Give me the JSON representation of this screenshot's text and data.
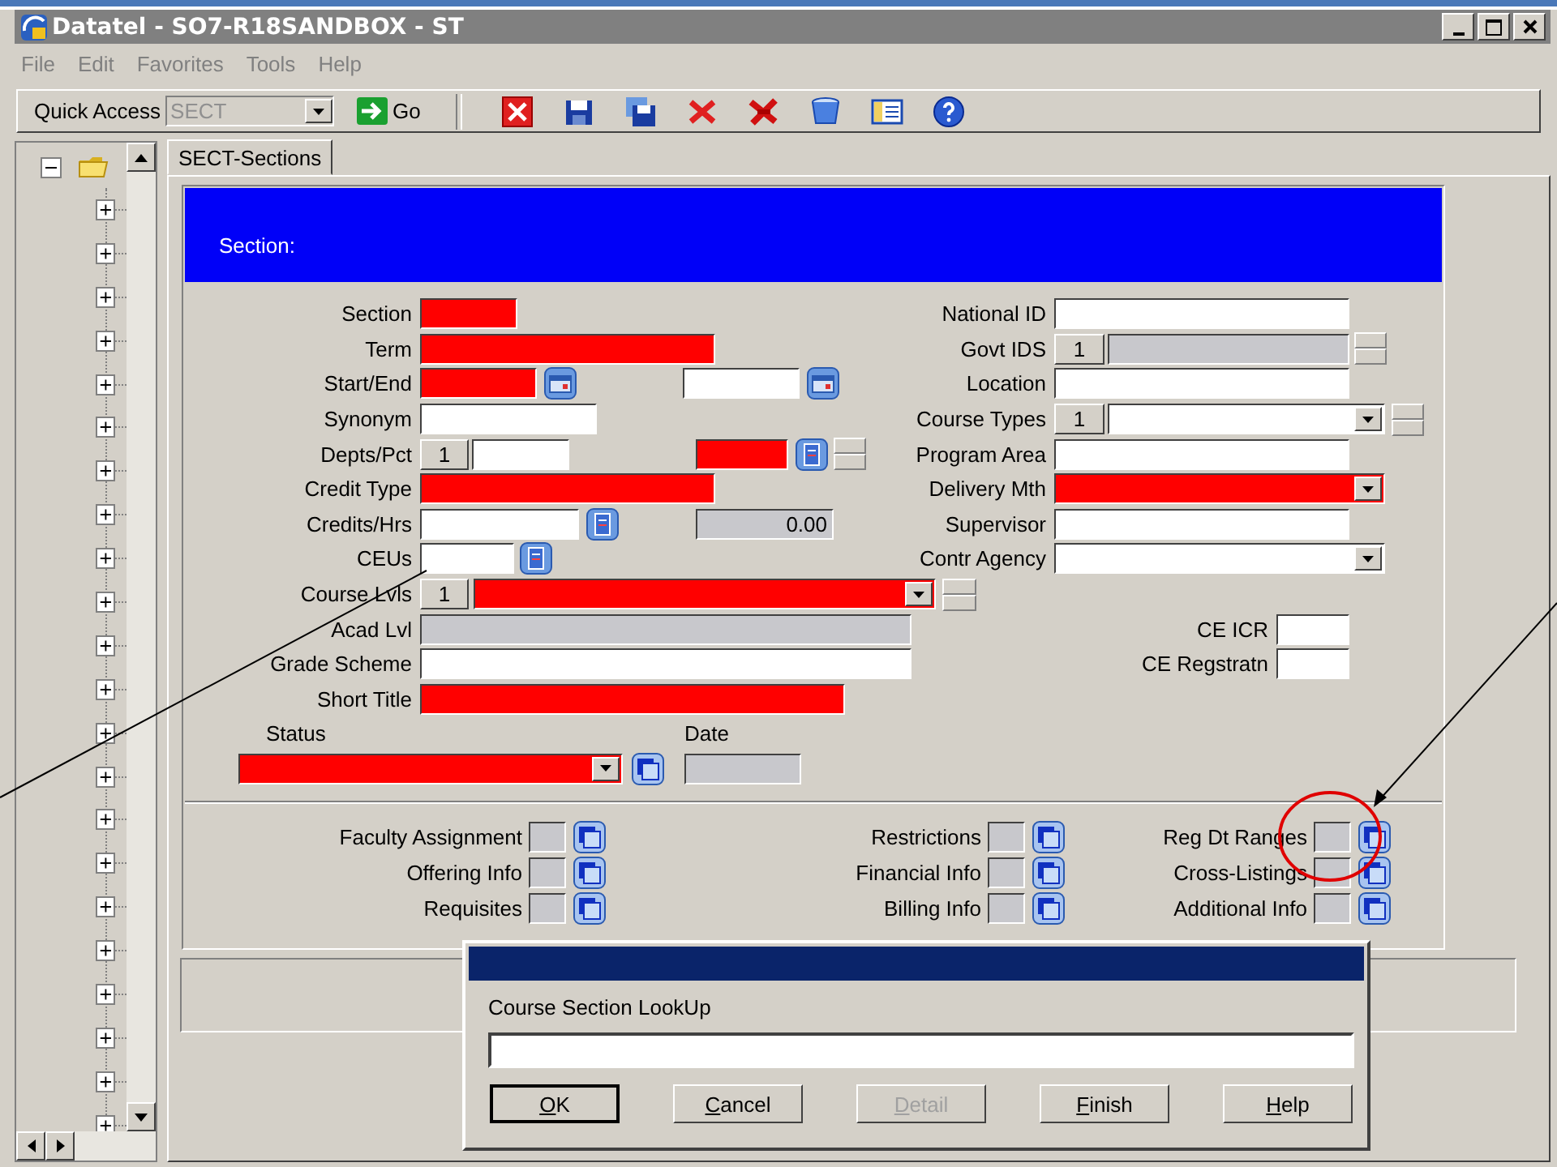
{
  "window": {
    "title": "Datatel - SO7-R18SANDBOX - ST"
  },
  "menu": [
    "File",
    "Edit",
    "Favorites",
    "Tools",
    "Help"
  ],
  "toolbar": {
    "quick_access_label": "Quick Access",
    "quick_access_value": "SECT",
    "quick_access_disabled": true,
    "go_label": "Go"
  },
  "tree": {
    "expanded": true,
    "children": [
      {
        "expanded": false
      },
      {
        "expanded": false
      },
      {
        "expanded": false
      },
      {
        "expanded": false
      },
      {
        "expanded": false
      },
      {
        "expanded": false
      },
      {
        "expanded": false
      },
      {
        "expanded": false
      },
      {
        "expanded": false
      },
      {
        "expanded": false
      },
      {
        "expanded": false
      },
      {
        "expanded": false
      },
      {
        "expanded": false
      },
      {
        "expanded": false
      },
      {
        "expanded": false
      },
      {
        "expanded": false
      },
      {
        "expanded": false
      },
      {
        "expanded": false
      },
      {
        "expanded": false
      },
      {
        "expanded": false
      },
      {
        "expanded": false
      },
      {
        "expanded": false
      }
    ]
  },
  "tabs": [
    {
      "label": "SECT-Sections",
      "selected": true
    }
  ],
  "form": {
    "header": "Section:",
    "left_rows": [
      {
        "label": "Section",
        "controls": [
          {
            "kind": "field",
            "required": true
          }
        ]
      },
      {
        "label": "Term",
        "controls": [
          {
            "kind": "field",
            "required": true
          }
        ]
      },
      {
        "label": "Start/End",
        "controls": [
          {
            "kind": "field",
            "required": true
          },
          {
            "kind": "calendar"
          },
          {
            "kind": "field",
            "required": false
          },
          {
            "kind": "calendar"
          }
        ]
      },
      {
        "label": "Synonym",
        "controls": [
          {
            "kind": "field",
            "required": false
          }
        ]
      },
      {
        "label": "Depts/Pct",
        "controls": [
          {
            "kind": "counter",
            "value": "1"
          },
          {
            "kind": "field",
            "required": false
          },
          {
            "kind": "field",
            "required": true
          },
          {
            "kind": "detail"
          },
          {
            "kind": "spinner"
          }
        ]
      },
      {
        "label": "Credit Type",
        "controls": [
          {
            "kind": "field",
            "required": true
          }
        ]
      },
      {
        "label": "Credits/Hrs",
        "controls": [
          {
            "kind": "field",
            "required": false
          },
          {
            "kind": "detail"
          },
          {
            "kind": "display",
            "value": "0.00"
          }
        ]
      },
      {
        "label": "CEUs",
        "controls": [
          {
            "kind": "field",
            "required": false
          },
          {
            "kind": "detail"
          }
        ]
      },
      {
        "label": "Course Lvls",
        "controls": [
          {
            "kind": "counter",
            "value": "1"
          },
          {
            "kind": "dropdown",
            "required": true
          },
          {
            "kind": "spinner"
          }
        ]
      },
      {
        "label": "Acad Lvl",
        "controls": [
          {
            "kind": "display"
          }
        ]
      },
      {
        "label": "Grade Scheme",
        "controls": [
          {
            "kind": "field",
            "required": false
          }
        ]
      },
      {
        "label": "Short Title",
        "controls": [
          {
            "kind": "field",
            "required": true
          }
        ]
      }
    ],
    "right_rows": [
      {
        "label": "National ID",
        "controls": [
          {
            "kind": "field",
            "required": false
          }
        ]
      },
      {
        "label": "Govt IDS",
        "controls": [
          {
            "kind": "counter",
            "value": "1"
          },
          {
            "kind": "display"
          },
          {
            "kind": "spinner"
          }
        ]
      },
      {
        "label": "Location",
        "controls": [
          {
            "kind": "field",
            "required": false
          }
        ]
      },
      {
        "label": "Course Types",
        "controls": [
          {
            "kind": "counter",
            "value": "1"
          },
          {
            "kind": "dropdown",
            "required": false
          },
          {
            "kind": "spinner"
          }
        ]
      },
      {
        "label": "Program Area",
        "controls": [
          {
            "kind": "field",
            "required": false
          }
        ]
      },
      {
        "label": "Delivery Mth",
        "controls": [
          {
            "kind": "dropdown",
            "required": true
          }
        ]
      },
      {
        "label": "Supervisor",
        "controls": [
          {
            "kind": "field",
            "required": false
          }
        ]
      },
      {
        "label": "Contr Agency",
        "controls": [
          {
            "kind": "dropdown",
            "required": false
          }
        ]
      },
      {
        "label": "CE ICR",
        "controls": [
          {
            "kind": "field",
            "required": false
          }
        ]
      },
      {
        "label": "CE Regstratn",
        "controls": [
          {
            "kind": "field",
            "required": false
          }
        ]
      }
    ],
    "status_label": "Status",
    "date_label": "Date",
    "status_controls": [
      {
        "kind": "dropdown",
        "required": true
      },
      {
        "kind": "lookup"
      },
      {
        "kind": "display"
      }
    ],
    "links": [
      [
        {
          "label": "Faculty Assignment"
        },
        {
          "label": "Offering Info"
        },
        {
          "label": "Requisites"
        }
      ],
      [
        {
          "label": "Restrictions"
        },
        {
          "label": "Financial Info"
        },
        {
          "label": "Billing Info"
        }
      ],
      [
        {
          "label": "Reg Dt Ranges"
        },
        {
          "label": "Cross-Listings"
        },
        {
          "label": "Additional Info"
        }
      ]
    ]
  },
  "dialog": {
    "prompt": "Course Section LookUp",
    "buttons": [
      {
        "label": "OK",
        "default": true,
        "disabled": false
      },
      {
        "label": "Cancel",
        "default": false,
        "disabled": false
      },
      {
        "label": "Detail",
        "default": false,
        "disabled": true
      },
      {
        "label": "Finish",
        "default": false,
        "disabled": false
      },
      {
        "label": "Help",
        "default": false,
        "disabled": false
      }
    ]
  }
}
